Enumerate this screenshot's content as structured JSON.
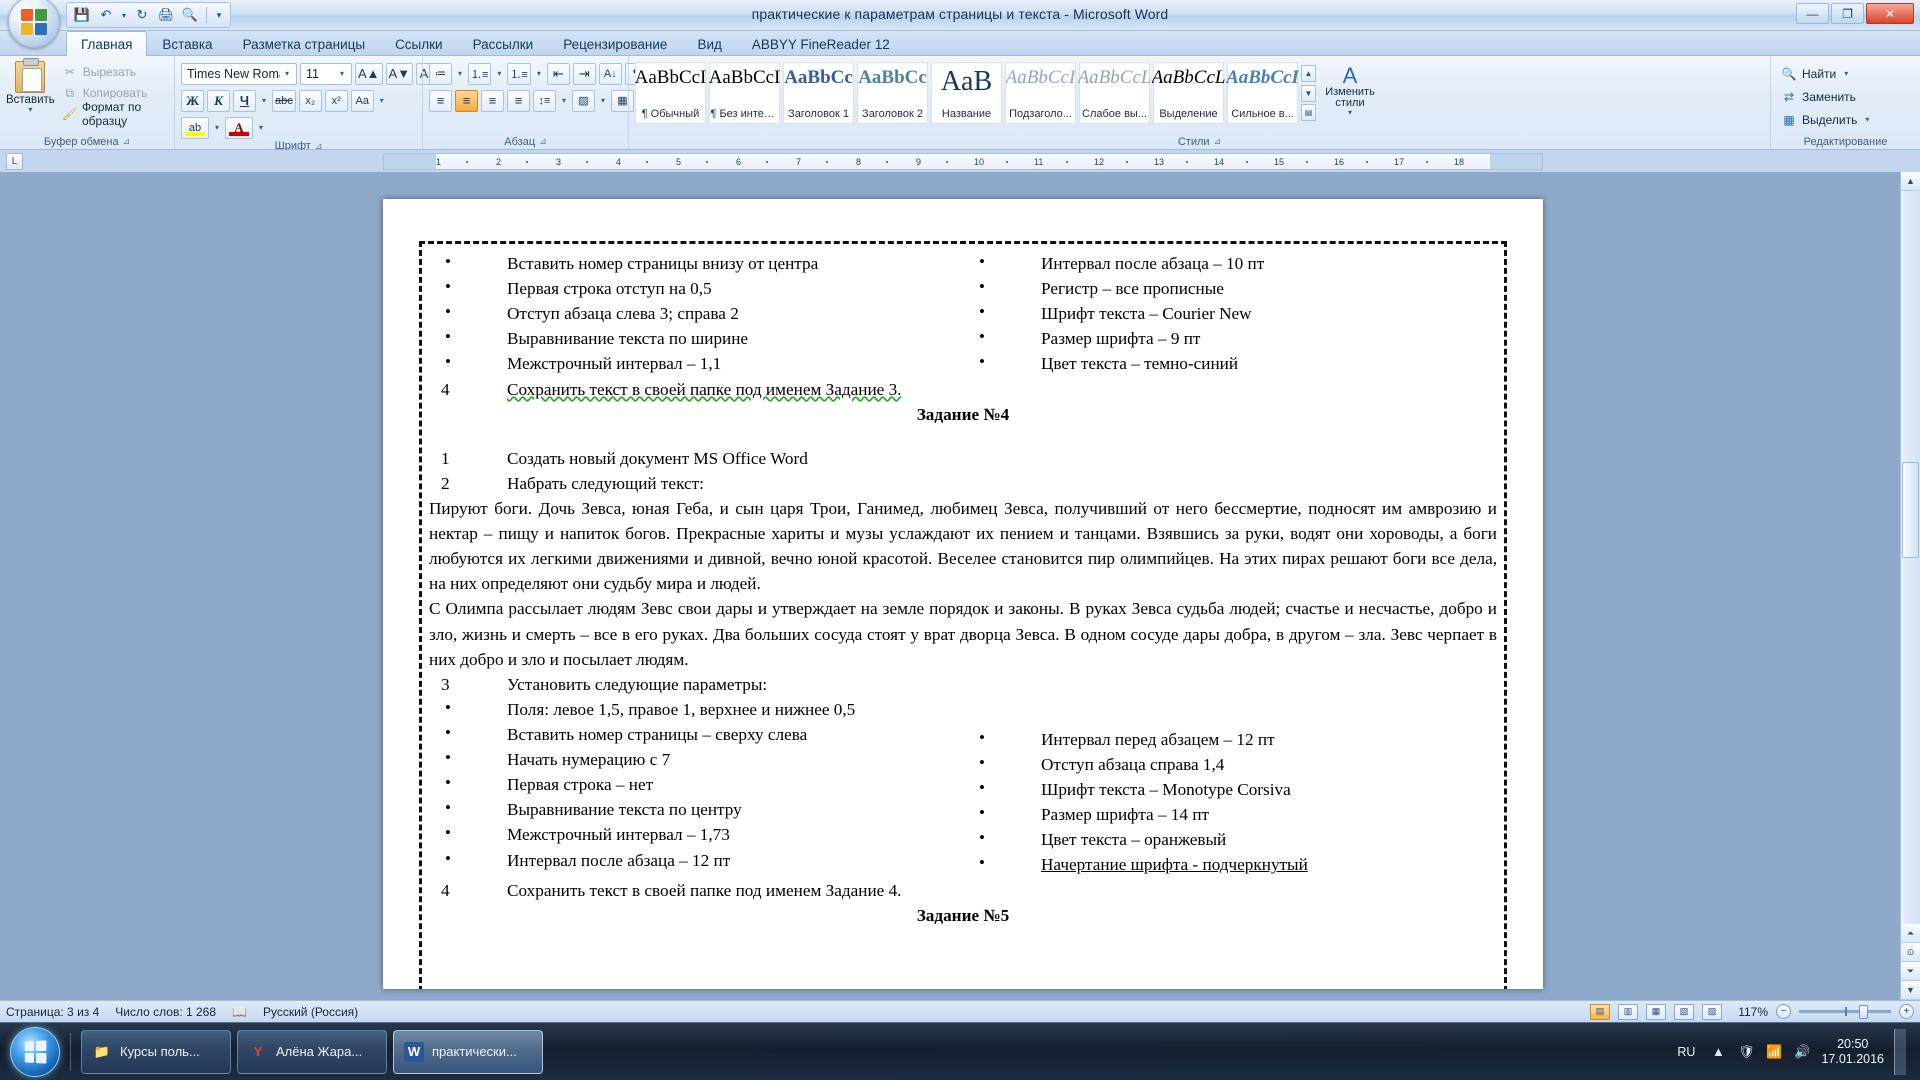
{
  "window": {
    "title": "практические к параметрам страницы и текста - Microsoft Word",
    "minimize": "—",
    "maximize": "❐",
    "close": "✕"
  },
  "quick_access": {
    "save": "💾",
    "undo": "↶",
    "undo_caret": "▾",
    "redo": "↻",
    "print": "🖨",
    "preview": "🔍",
    "customize": "▾"
  },
  "tabs": [
    {
      "label": "Главная",
      "active": true
    },
    {
      "label": "Вставка",
      "active": false
    },
    {
      "label": "Разметка страницы",
      "active": false
    },
    {
      "label": "Ссылки",
      "active": false
    },
    {
      "label": "Рассылки",
      "active": false
    },
    {
      "label": "Рецензирование",
      "active": false
    },
    {
      "label": "Вид",
      "active": false
    },
    {
      "label": "ABBYY FineReader 12",
      "active": false
    }
  ],
  "ribbon": {
    "clipboard": {
      "group_label": "Буфер обмена",
      "paste_label": "Вставить",
      "paste_caret": "▾",
      "cut_label": "Вырезать",
      "copy_label": "Копировать",
      "format_painter_label": "Формат по образцу"
    },
    "font": {
      "group_label": "Шрифт",
      "font_name": "Times New Roman",
      "font_size": "11",
      "grow_font": "A▲",
      "shrink_font": "A▼",
      "clear_format": "Aa",
      "bold": "Ж",
      "italic": "К",
      "underline": "Ч",
      "strikethrough": "abc",
      "subscript": "x₂",
      "superscript": "x²",
      "change_case": "Aa",
      "highlight": "ab",
      "highlight_color": "#ffff00",
      "font_color": "A",
      "font_color_value": "#cc0000"
    },
    "paragraph": {
      "group_label": "Абзац",
      "bullets": "≔",
      "numbering": "⒈≡",
      "multilevel": "⒈≡",
      "decrease_indent": "⇤",
      "increase_indent": "⇥",
      "sort": "A↓",
      "show_marks": "¶",
      "align_left": "≡",
      "align_center": "≡",
      "align_right": "≡",
      "justify": "≡",
      "line_spacing": "↕≡",
      "shading": "▨",
      "borders": "▦"
    },
    "styles": {
      "group_label": "Стили",
      "items": [
        {
          "sample": "AaBbCcI",
          "name": "¶ Обычный",
          "color": "#000000",
          "weight": "normal",
          "style": "normal"
        },
        {
          "sample": "AaBbCcI",
          "name": "¶ Без интер...",
          "color": "#000000",
          "weight": "normal",
          "style": "normal"
        },
        {
          "sample": "AaBbCc",
          "name": "Заголовок 1",
          "color": "#365f91",
          "weight": "bold",
          "style": "normal"
        },
        {
          "sample": "AaBbCc",
          "name": "Заголовок 2",
          "color": "#4f81a8",
          "weight": "bold",
          "style": "normal"
        },
        {
          "sample": "AaB",
          "name": "Название",
          "color": "#17365d",
          "weight": "normal",
          "style": "normal"
        },
        {
          "sample": "AaBbCcI",
          "name": "Подзаголо...",
          "color": "#8aa8c8",
          "weight": "normal",
          "style": "italic"
        },
        {
          "sample": "AaBbCcL",
          "name": "Слабое вы...",
          "color": "#9aa3ad",
          "weight": "normal",
          "style": "italic"
        },
        {
          "sample": "AaBbCcL",
          "name": "Выделение",
          "color": "#000000",
          "weight": "normal",
          "style": "italic"
        },
        {
          "sample": "AaBbCcI",
          "name": "Сильное в...",
          "color": "#4a7ebb",
          "weight": "bold",
          "style": "italic"
        }
      ],
      "scroll_up": "▲",
      "scroll_down": "▼",
      "scroll_more": "▤",
      "change_styles_icon": "A",
      "change_styles_label": "Изменить стили",
      "change_styles_caret": "▾"
    },
    "editing": {
      "group_label": "Редактирование",
      "find": "Найти",
      "find_caret": "▾",
      "replace": "Заменить",
      "select": "Выделить",
      "select_caret": "▾",
      "find_icon": "🔍",
      "replace_icon": "⇄",
      "select_icon": "▦"
    }
  },
  "ruler": {
    "corner_tab_stop": "L",
    "labels": [
      "1",
      "2",
      "3",
      "4",
      "5",
      "6",
      "7",
      "8",
      "9",
      "10",
      "11",
      "12",
      "13",
      "14",
      "15",
      "16",
      "17",
      "18"
    ]
  },
  "document": {
    "task3_bullets_left": [
      "Вставить номер страницы внизу от центра",
      "Первая строка отступ на 0,5",
      "Отступ абзаца слева  3; справа  2",
      "Выравнивание текста по ширине",
      "Межстрочный интервал – 1,1"
    ],
    "task3_bullets_right": [
      "Интервал после абзаца – 10 пт",
      "Регистр – все прописные",
      "Шрифт текста – Courier New",
      "Размер шрифта – 9 пт",
      "Цвет текста – темно-синий"
    ],
    "task3_save_num": "4",
    "task3_save_text": "Сохранить текст в своей папке под именем Задание 3.",
    "task4_heading": "Задание №4",
    "task4_step1_num": "1",
    "task4_step1_text": "Создать новый документ MS Office Word",
    "task4_step2_num": "2",
    "task4_step2_text": "Набрать следующий текст:",
    "task4_para1": "Пируют боги. Дочь Зевса, юная Геба, и сын царя Трои, Ганимед, любимец Зевса, получивший от него бессмертие, подносят им амврозию и нектар – пищу и напиток богов. Прекрасные хариты и музы услаждают их пением и танцами. Взявшись за руки, водят они хороводы, а боги любуются их легкими движениями и дивной, вечно юной красотой. Веселее становится пир олимпийцев. На этих пирах решают боги все дела, на них определяют они судьбу мира и людей.",
    "task4_para2": "С Олимпа рассылает людям Зевс свои дары и утверждает на земле порядок и законы. В руках Зевса судьба людей; счастье и несчастье, добро и зло, жизнь и смерть – все в его руках. Два больших сосуда стоят у врат дворца Зевса. В одном сосуде дары добра, в другом – зла. Зевс черпает в них добро и зло и посылает людям.",
    "task4_step3_num": "3",
    "task4_step3_text": "Установить следующие параметры:",
    "task4_bullets_left": [
      "Поля: левое  1,5, правое  1, верхнее и нижнее  0,5",
      "Вставить номер страницы – сверху слева",
      "Начать нумерацию с 7",
      "Первая строка – нет",
      "Выравнивание текста по центру",
      "Межстрочный интервал – 1,73",
      "Интервал после абзаца – 12 пт"
    ],
    "task4_bullets_right": [
      "Интервал перед абзацем – 12 пт",
      "Отступ абзаца справа  1,4",
      "Шрифт текста – Monotype Corsiva",
      "Размер шрифта – 14 пт",
      "Цвет текста – оранжевый",
      "Начертание шрифта - подчеркнутый"
    ],
    "task4_save_num": "4",
    "task4_save_text": "Сохранить текст в своей папке под именем Задание 4.",
    "task5_heading": "Задание №5"
  },
  "statusbar": {
    "page": "Страница: 3 из 4",
    "words": "Число слов: 1 268",
    "language": "Русский (Россия)",
    "proof_icon": "📖",
    "views": [
      {
        "name": "print-layout",
        "glyph": "▤",
        "active": true
      },
      {
        "name": "full-screen-reading",
        "glyph": "▥",
        "active": false
      },
      {
        "name": "web-layout",
        "glyph": "▦",
        "active": false
      },
      {
        "name": "outline",
        "glyph": "▧",
        "active": false
      },
      {
        "name": "draft",
        "glyph": "▨",
        "active": false
      }
    ],
    "zoom": "117%",
    "zoom_out": "−",
    "zoom_in": "+"
  },
  "taskbar": {
    "start_label": "",
    "items": [
      {
        "label": "Курсы поль...",
        "icon": "📁",
        "icon_color": "#f4c04a",
        "active": false
      },
      {
        "label": "Алёна Жара...",
        "icon": "Y",
        "icon_color": "#c8352a",
        "active": false
      },
      {
        "label": "практически...",
        "icon": "W",
        "icon_color": "#2b5797",
        "active": true
      }
    ],
    "language": "RU",
    "tray_expand": "▲",
    "tray_icons": [
      "🛡",
      "📶",
      "🔊"
    ],
    "time": "20:50",
    "date": "17.01.2016"
  }
}
